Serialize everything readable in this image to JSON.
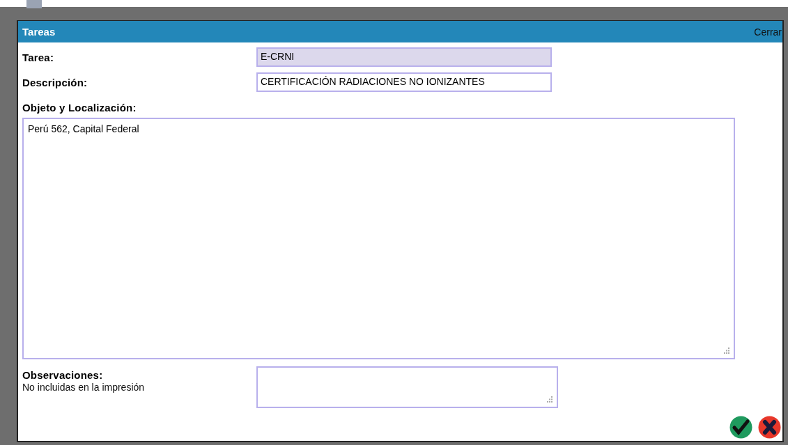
{
  "window": {
    "title": "Tareas",
    "close_label": "Cerrar"
  },
  "fields": [
    {
      "kind": "line",
      "label": "Tarea:",
      "value": "E-CRNI",
      "disabled": true
    },
    {
      "kind": "line",
      "label": "Descripción:",
      "value": "CERTIFICACIÓN RADIACIONES NO IONIZANTES",
      "disabled": false
    },
    {
      "kind": "area",
      "label": "Objeto y Localización:",
      "value": "Perú 562, Capital Federal",
      "disabled": false
    },
    {
      "kind": "side-area",
      "label": "Observaciones:",
      "note": "No incluidas en la impresión",
      "disabled": false
    }
  ]
}
